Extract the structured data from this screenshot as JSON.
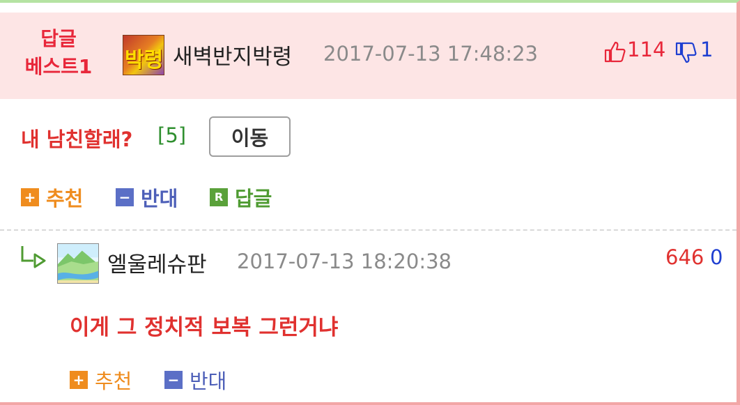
{
  "best_comment": {
    "badge_line1": "답글",
    "badge_line2": "베스트1",
    "avatar_text": "박령",
    "username": "새벽반지박령",
    "datetime": "2017-07-13 17:48:23",
    "upvotes": "114",
    "downvotes": "1"
  },
  "post": {
    "title": "내 남친할래?",
    "reply_count": "[5]",
    "move_button": "이동"
  },
  "actions": {
    "recommend": "추천",
    "oppose": "반대",
    "reply": "답글",
    "reply_icon": "R",
    "plus_icon": "+",
    "minus_icon": "−"
  },
  "reply_comment": {
    "username": "엘울레슈판",
    "datetime": "2017-07-13 18:20:38",
    "score_up": "646",
    "score_down": "0",
    "text": "이게 그 정치적 보복 그런거냐"
  },
  "colors": {
    "accent_red": "#e0312f",
    "accent_orange": "#ef8c1e",
    "accent_blue": "#4d5fb8",
    "accent_green": "#4f9b32",
    "header_bg": "#fde5e5"
  }
}
